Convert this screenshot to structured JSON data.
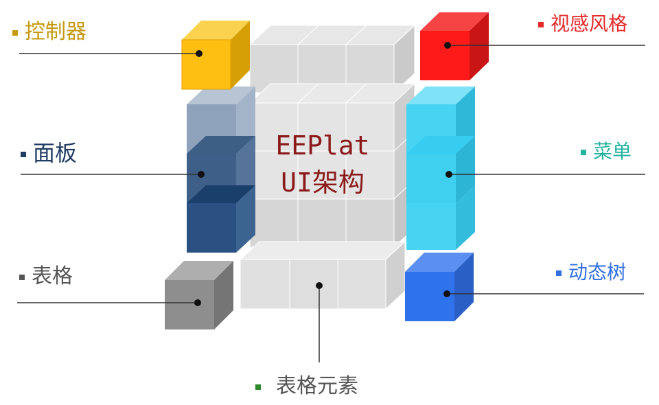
{
  "title": {
    "line1": "EEPlat",
    "line2": "UI架构"
  },
  "labels": {
    "controller": {
      "text": "控制器",
      "color": "#c59a10"
    },
    "visual_style": {
      "text": "视感风格",
      "color": "#e52a2a"
    },
    "panel": {
      "text": "面板",
      "color": "#1f3d63"
    },
    "menu": {
      "text": "菜单",
      "color": "#22b3a0"
    },
    "table": {
      "text": "表格",
      "color": "#555555"
    },
    "dynamic_tree": {
      "text": "动态树",
      "color": "#2f6fe0"
    },
    "table_element": {
      "text": "表格元素",
      "color": "#555555",
      "marker_color": "#2a8a2a"
    }
  }
}
